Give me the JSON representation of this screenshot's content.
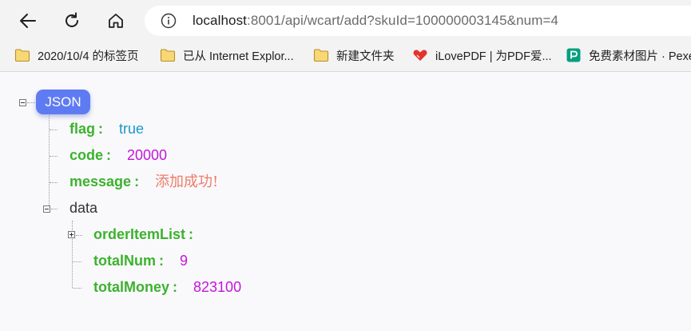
{
  "url": {
    "host": "localhost",
    "rest": ":8001/api/wcart/add?skuId=100000003145&num=4"
  },
  "bookmarks": [
    {
      "label": "2020/10/4 的标签页",
      "icon": "folder-icon"
    },
    {
      "label": "已从 Internet Explor...",
      "icon": "folder-icon"
    },
    {
      "label": "新建文件夹",
      "icon": "folder-icon"
    },
    {
      "label": "iLovePDF | 为PDF爱...",
      "icon": "heart-icon"
    },
    {
      "label": "免费素材图片 · Pexe",
      "icon": "pexels-icon"
    }
  ],
  "json_view": {
    "root_label": "JSON",
    "colon": ":",
    "rows": {
      "flag": {
        "key": "flag",
        "value": "true"
      },
      "code": {
        "key": "code",
        "value": "20000"
      },
      "message": {
        "key": "message",
        "value": "添加成功!"
      },
      "data": {
        "key": "data"
      },
      "orderItemList": {
        "key": "orderItemList"
      },
      "totalNum": {
        "key": "totalNum",
        "value": "9"
      },
      "totalMoney": {
        "key": "totalMoney",
        "value": "823100"
      }
    }
  },
  "colors": {
    "root_pill": "#5f7bf2",
    "key_green": "#3cb22d",
    "bool_blue": "#1c97c7",
    "number_magenta": "#c415d9",
    "string_salmon": "#ee7c68"
  }
}
